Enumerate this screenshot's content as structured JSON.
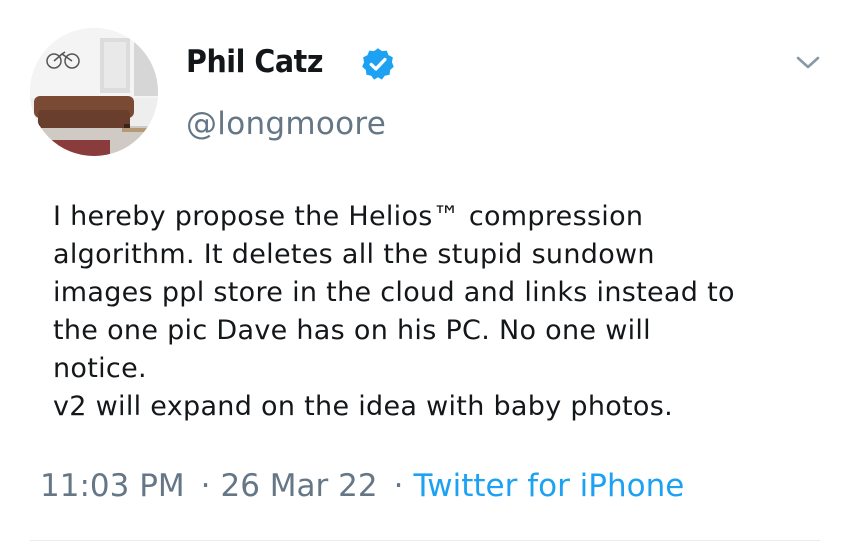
{
  "author": {
    "display_name": "Phil Catz",
    "handle": "@longmoore",
    "verified": true
  },
  "tweet": {
    "lines": [
      "I hereby propose the Helios™ compression",
      "algorithm. It deletes all the stupid sundown",
      "images ppl store in the cloud and links instead to",
      "the one pic Dave has on his PC. No one will",
      "notice.",
      "v2 will expand on the idea with baby photos."
    ],
    "time": "11:03 PM",
    "date": "26 Mar 22",
    "separator": "·",
    "source": "Twitter for iPhone"
  },
  "colors": {
    "link": "#1da1f2",
    "secondary_text": "#657786",
    "verified_badge": "#1da1f2"
  },
  "icons": {
    "verified": "verified-badge-icon",
    "more": "chevron-down-icon"
  }
}
